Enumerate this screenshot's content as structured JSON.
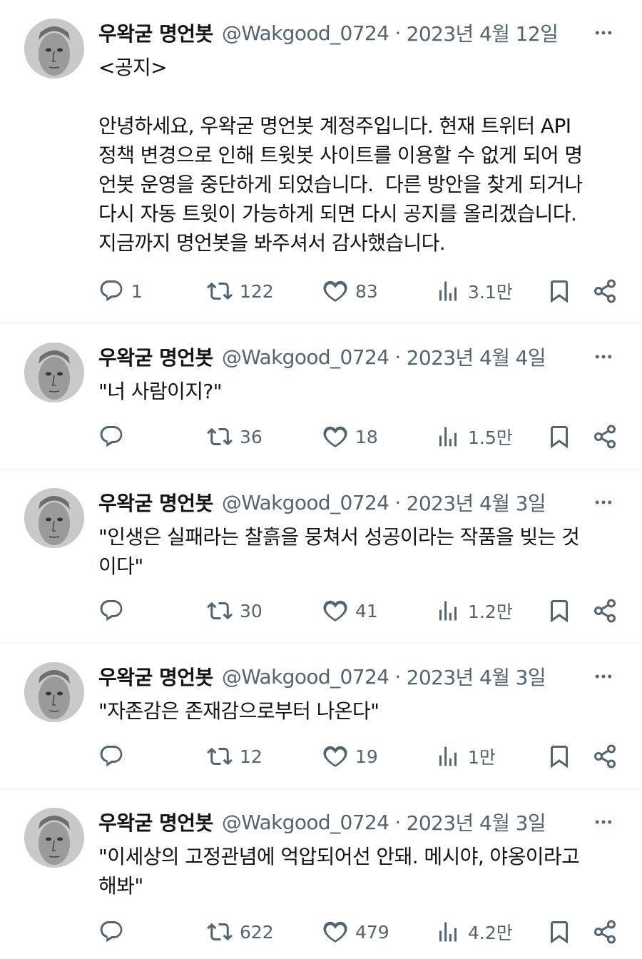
{
  "tweets": [
    {
      "display_name": "우왁굳 명언봇",
      "handle": "@Wakgood_0724",
      "separator": "·",
      "date": "2023년 4월 12일",
      "text": "<공지>\n\n안녕하세요, 우왁굳 명언봇 계정주입니다. 현재 트위터 API\n정책 변경으로 인해 트윗봇 사이트를 이용할 수 없게 되어 명\n언봇 운영을 중단하게 되었습니다.  다른 방안을 찾게 되거나\n다시 자동 트윗이 가능하게 되면 다시 공지를 올리겠습니다.\n지금까지 명언봇을 봐주셔서 감사했습니다.",
      "replies": "1",
      "retweets": "122",
      "likes": "83",
      "views": "3.1만"
    },
    {
      "display_name": "우왁굳 명언봇",
      "handle": "@Wakgood_0724",
      "separator": "·",
      "date": "2023년 4월 4일",
      "text": "\"너 사람이지?\"",
      "replies": "",
      "retweets": "36",
      "likes": "18",
      "views": "1.5만"
    },
    {
      "display_name": "우왁굳 명언봇",
      "handle": "@Wakgood_0724",
      "separator": "·",
      "date": "2023년 4월 3일",
      "text": "\"인생은 실패라는 찰흙을 뭉쳐서 성공이라는 작품을 빚는 것\n이다\"",
      "replies": "",
      "retweets": "30",
      "likes": "41",
      "views": "1.2만"
    },
    {
      "display_name": "우왁굳 명언봇",
      "handle": "@Wakgood_0724",
      "separator": "·",
      "date": "2023년 4월 3일",
      "text": "\"자존감은 존재감으로부터 나온다\"",
      "replies": "",
      "retweets": "12",
      "likes": "19",
      "views": "1만"
    },
    {
      "display_name": "우왁굳 명언봇",
      "handle": "@Wakgood_0724",
      "separator": "·",
      "date": "2023년 4월 3일",
      "text": "\"이세상의 고정관념에 억압되어선 안돼. 메시야, 야옹이라고\n해봐\"",
      "replies": "",
      "retweets": "622",
      "likes": "479",
      "views": "4.2만"
    }
  ],
  "icons": {
    "reply": "reply-icon",
    "retweet": "retweet-icon",
    "like": "heart-icon",
    "views": "views-icon",
    "bookmark": "bookmark-icon",
    "share": "share-icon",
    "more": "more-icon"
  },
  "colors": {
    "text": "#0f1419",
    "secondary": "#536471",
    "divider": "#eff3f4"
  }
}
